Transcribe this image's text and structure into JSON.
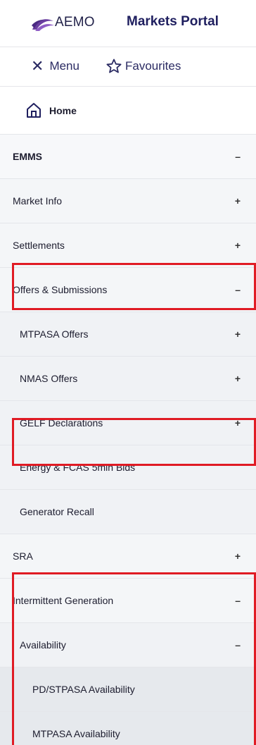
{
  "header": {
    "logo_text": "AEMO",
    "portal_title": "Markets Portal"
  },
  "toolbar": {
    "menu_label": "Menu",
    "favourites_label": "Favourites"
  },
  "home": {
    "label": "Home"
  },
  "nav": {
    "items": [
      {
        "label": "EMMS",
        "sign": "–"
      },
      {
        "label": "Market Info",
        "sign": "+"
      },
      {
        "label": "Settlements",
        "sign": "+"
      },
      {
        "label": "Offers & Submissions",
        "sign": "–"
      },
      {
        "label": "MTPASA Offers",
        "sign": "+"
      },
      {
        "label": "NMAS Offers",
        "sign": "+"
      },
      {
        "label": "GELF Declarations",
        "sign": "+"
      },
      {
        "label": "Energy & FCAS 5min Bids",
        "sign": ""
      },
      {
        "label": "Generator Recall",
        "sign": ""
      },
      {
        "label": "SRA",
        "sign": "+"
      },
      {
        "label": "Intermittent Generation",
        "sign": "–"
      },
      {
        "label": "Availability",
        "sign": "–"
      },
      {
        "label": "PD/STPASA Availability",
        "sign": ""
      },
      {
        "label": "MTPASA Availability",
        "sign": ""
      }
    ]
  },
  "colors": {
    "highlight": "#e01b24",
    "brand_navy": "#1f1f5f",
    "logo_purple": "#6b3fa0"
  }
}
